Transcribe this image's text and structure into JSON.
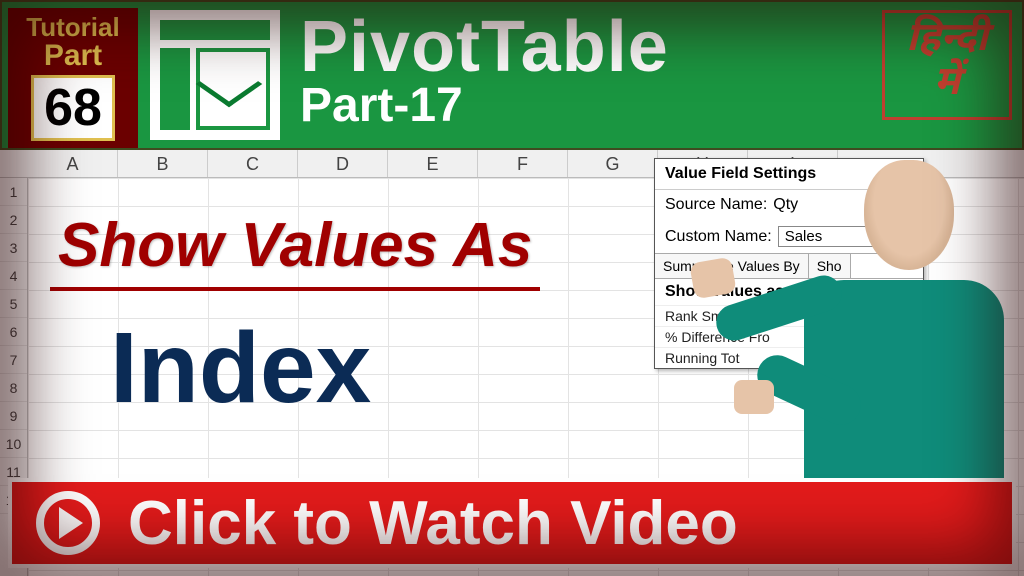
{
  "badge": {
    "tutorial": "Tutorial",
    "part": "Part",
    "number": "68"
  },
  "header": {
    "title": "PivotTable",
    "subtitle": "Part-17"
  },
  "hindi": {
    "line1": "हिन्दी",
    "line2": "में"
  },
  "columns": [
    "A",
    "B",
    "C",
    "D",
    "E",
    "F",
    "G",
    "H",
    "I"
  ],
  "rows": [
    "1",
    "2",
    "3",
    "4",
    "5",
    "6",
    "7",
    "8",
    "9",
    "10",
    "11",
    "12"
  ],
  "center": {
    "line1": "Show Values As",
    "line2": "Index"
  },
  "dialog": {
    "title": "Value Field Settings",
    "source_label": "Source Name:",
    "source_value": "Qty",
    "custom_label": "Custom Name:",
    "custom_value": "Sales",
    "tab1": "Summarize Values By",
    "tab2": "Sho",
    "subhead": "Show values as",
    "list1": "Rank Smallest to La",
    "list2": "% Difference Fro",
    "list3": "Running Tot"
  },
  "cta": {
    "text": "Click to Watch Video"
  }
}
